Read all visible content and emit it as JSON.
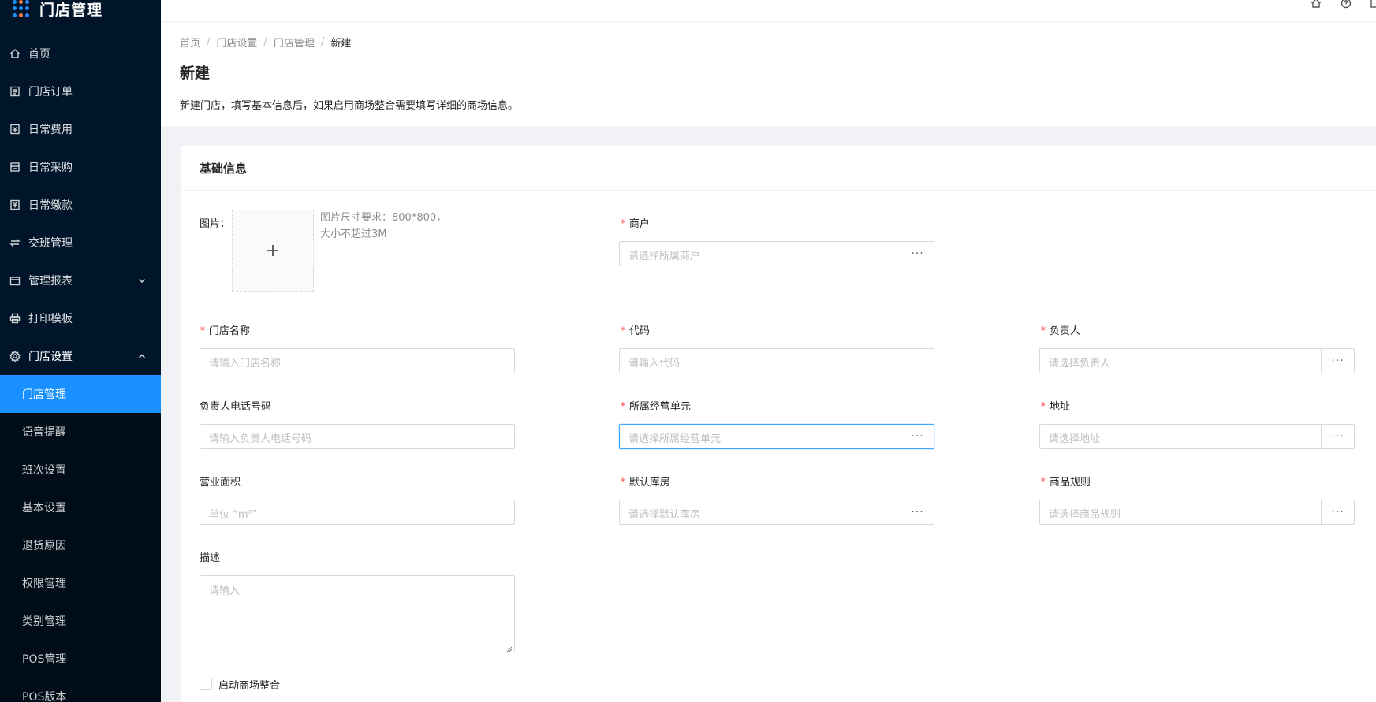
{
  "app": {
    "title": "门店管理"
  },
  "sidebar": {
    "items": [
      {
        "label": "首页",
        "icon": "home-icon"
      },
      {
        "label": "门店订单",
        "icon": "order-icon"
      },
      {
        "label": "日常费用",
        "icon": "expense-icon"
      },
      {
        "label": "日常采购",
        "icon": "purchase-icon"
      },
      {
        "label": "日常缴款",
        "icon": "payment-icon"
      },
      {
        "label": "交班管理",
        "icon": "swap-icon"
      },
      {
        "label": "管理报表",
        "icon": "calendar-icon"
      },
      {
        "label": "打印模板",
        "icon": "printer-icon"
      },
      {
        "label": "门店设置",
        "icon": "gear-icon"
      }
    ],
    "submenu": [
      {
        "label": "门店管理",
        "active": true
      },
      {
        "label": "语音提醒"
      },
      {
        "label": "班次设置"
      },
      {
        "label": "基本设置"
      },
      {
        "label": "退货原因"
      },
      {
        "label": "权限管理"
      },
      {
        "label": "类别管理"
      },
      {
        "label": "POS管理"
      },
      {
        "label": "POS版本"
      }
    ],
    "active_color": "#1890ff",
    "bg_color": "#001529"
  },
  "breadcrumb": [
    "首页",
    "门店设置",
    "门店管理",
    "新建"
  ],
  "page": {
    "title": "新建",
    "description": "新建门店，填写基本信息后，如果启用商场整合需要填写详细的商场信息。"
  },
  "card": {
    "title": "基础信息"
  },
  "form": {
    "image_label": "图片：",
    "image_hint_line1": "图片尺寸要求：800*800，",
    "image_hint_line2": "大小不超过3M",
    "upload_symbol": "+",
    "merchant": {
      "label": "商户",
      "placeholder": "请选择所属商户"
    },
    "store_name": {
      "label": "门店名称",
      "placeholder": "请输入门店名称"
    },
    "code": {
      "label": "代码",
      "placeholder": "请输入代码"
    },
    "manager": {
      "label": "负责人",
      "placeholder": "请选择负责人"
    },
    "manager_phone": {
      "label": "负责人电话号码",
      "placeholder": "请输入负责人电话号码"
    },
    "business_unit": {
      "label": "所属经营单元",
      "placeholder": "请选择所属经营单元"
    },
    "address": {
      "label": "地址",
      "placeholder": "请选择地址"
    },
    "area": {
      "label": "营业面积",
      "placeholder": "单位 “m²”"
    },
    "warehouse": {
      "label": "默认库房",
      "placeholder": "请选择默认库房"
    },
    "product_rule": {
      "label": "商品规则",
      "placeholder": "请选择商品规则"
    },
    "description": {
      "label": "描述",
      "placeholder": "请输入"
    },
    "mall_integration": {
      "label": "启动商场整合",
      "checked": false
    },
    "more_symbol": "···",
    "required_mark": "*"
  }
}
